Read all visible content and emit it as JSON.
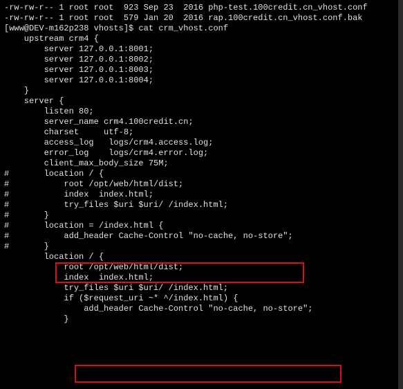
{
  "ls": {
    "line1": "-rw-rw-r-- 1 root root  923 Sep 23  2016 php-test.100credit.cn_vhost.conf",
    "line2": "-rw-rw-r-- 1 root root  579 Jan 20  2016 rap.100credit.cn_vhost.conf.bak"
  },
  "prompt": {
    "user_host": "[www@DEV-m162p238 vhosts]$",
    "command": "cat crm_vhost.conf"
  },
  "conf": {
    "l01": "    upstream crm4 {",
    "l02": "        server 127.0.0.1:8001;",
    "l03": "        server 127.0.0.1:8002;",
    "l04": "        server 127.0.0.1:8003;",
    "l05": "        server 127.0.0.1:8004;",
    "l06": "    }",
    "l07": "",
    "l08": "    server {",
    "l09": "        listen 80;",
    "l10": "        server_name crm4.100credit.cn;",
    "l11": "        charset     utf-8;",
    "l12": "",
    "l13": "        access_log   logs/crm4.access.log;",
    "l14": "        error_log    logs/crm4.error.log;",
    "l15": "",
    "l16": "        client_max_body_size 75M;",
    "l17": "#       location / {",
    "l18": "#           root /opt/web/html/dist;",
    "l19": "#           index  index.html;",
    "l20": "#           try_files $uri $uri/ /index.html;",
    "l21": "#       }",
    "l22": "#       location = /index.html {",
    "l23": "#           add_header Cache-Control \"no-cache, no-store\";",
    "l24": "#       }",
    "l25": "",
    "l26": "        location / {",
    "l27": "            root /opt/web/html/dist;",
    "l28": "            index  index.html;",
    "l29": "            try_files $uri $uri/ /index.html;",
    "l30": "            if ($request_uri ~* ^/index.html) {",
    "l31": "                add_header Cache-Control \"no-cache, no-store\";",
    "l32": "            }"
  }
}
